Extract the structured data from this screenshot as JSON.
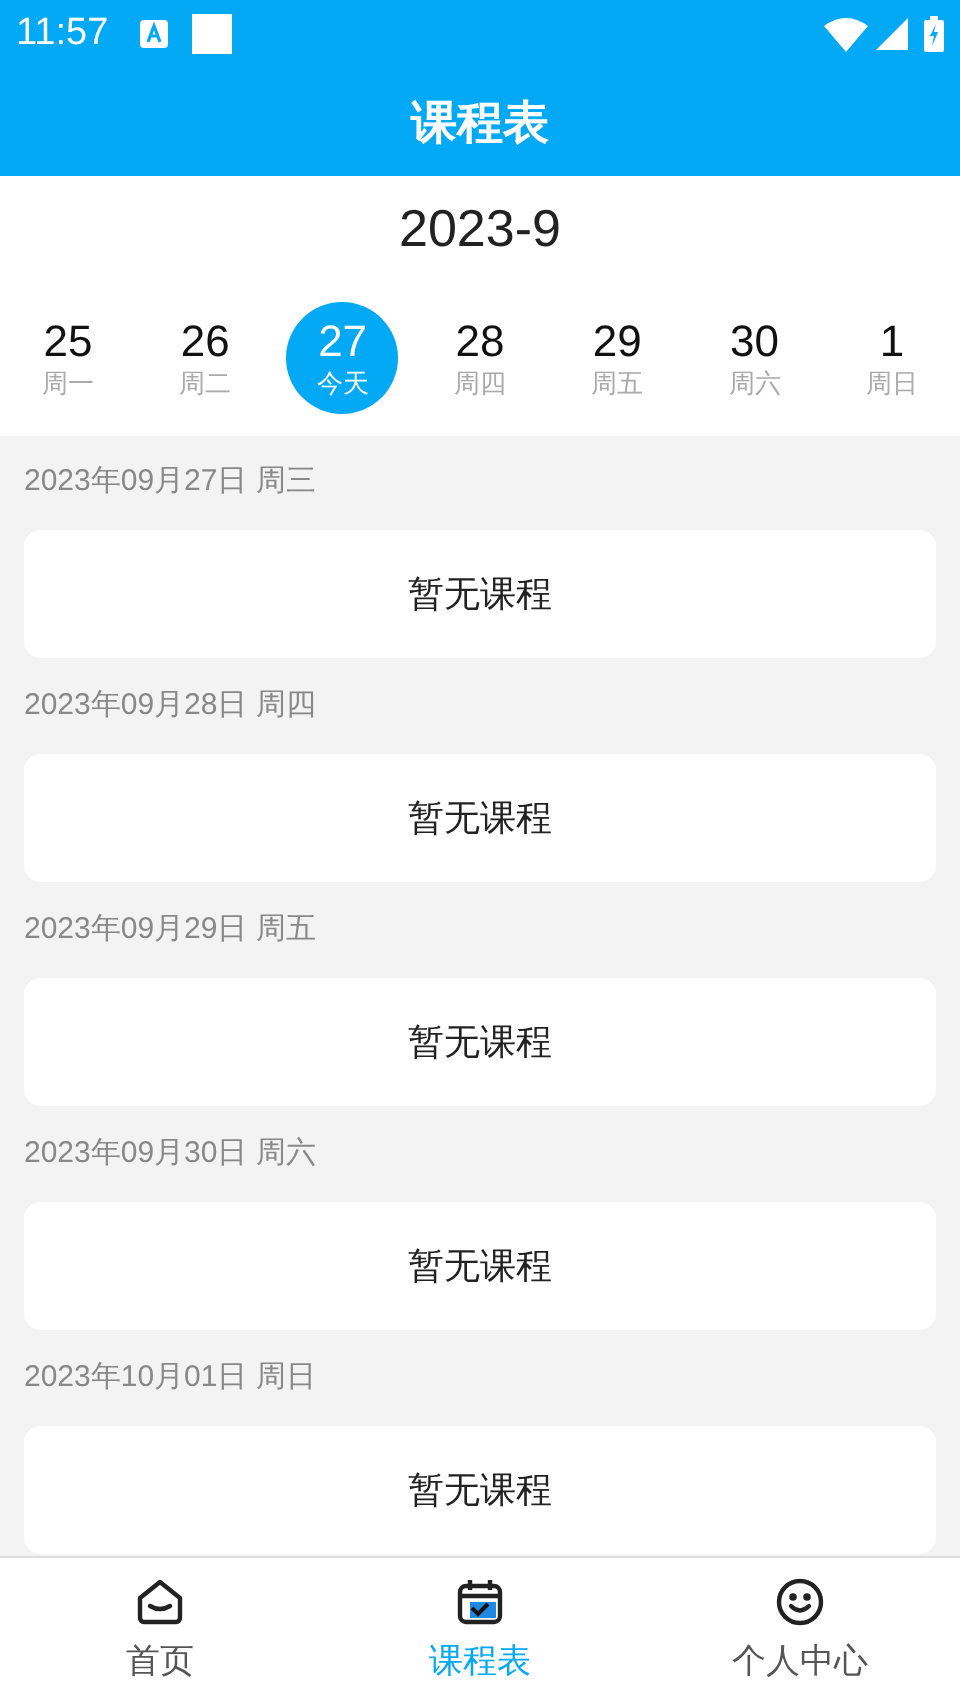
{
  "status_bar": {
    "time": "11:57"
  },
  "header": {
    "title": "课程表"
  },
  "month": "2023-9",
  "days": [
    {
      "date": "25",
      "label": "周一",
      "selected": false
    },
    {
      "date": "26",
      "label": "周二",
      "selected": false
    },
    {
      "date": "27",
      "label": "今天",
      "selected": true
    },
    {
      "date": "28",
      "label": "周四",
      "selected": false
    },
    {
      "date": "29",
      "label": "周五",
      "selected": false
    },
    {
      "date": "30",
      "label": "周六",
      "selected": false
    },
    {
      "date": "1",
      "label": "周日",
      "selected": false
    }
  ],
  "schedule": [
    {
      "heading": "2023年09月27日 周三",
      "content": "暂无课程"
    },
    {
      "heading": "2023年09月28日 周四",
      "content": "暂无课程"
    },
    {
      "heading": "2023年09月29日 周五",
      "content": "暂无课程"
    },
    {
      "heading": "2023年09月30日 周六",
      "content": "暂无课程"
    },
    {
      "heading": "2023年10月01日 周日",
      "content": "暂无课程"
    }
  ],
  "nav": [
    {
      "kind": "home",
      "label": "首页",
      "selected": false
    },
    {
      "kind": "calendar",
      "label": "课程表",
      "selected": true
    },
    {
      "kind": "profile",
      "label": "个人中心",
      "selected": false
    }
  ]
}
